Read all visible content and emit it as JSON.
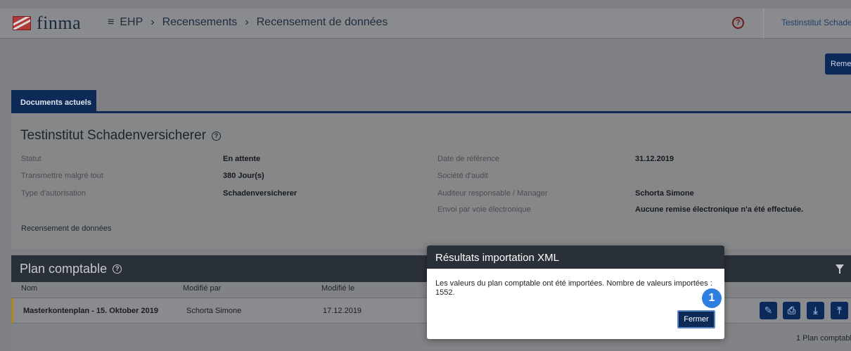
{
  "header": {
    "logo_text": "finma",
    "breadcrumb": [
      "EHP",
      "Recensements",
      "Recensement de données"
    ],
    "institution": "Testinstitut Schade"
  },
  "toolbar": {
    "submit_label": "Reme"
  },
  "tabs": [
    {
      "label": "Documents actuels",
      "active": true
    }
  ],
  "info": {
    "title": "Testinstitut Schadenversicherer",
    "fields_left": [
      {
        "label": "Statut",
        "value": "En attente"
      },
      {
        "label": "Transmettre malgré tout",
        "value": "380 Jour(s)"
      },
      {
        "label": "Type d'autorisation",
        "value": "Schadenversicherer"
      }
    ],
    "fields_right": [
      {
        "label": "Date de référence",
        "value": "31.12.2019"
      },
      {
        "label": "Société d'audit",
        "value": ""
      },
      {
        "label": "Auditeur responsable / Manager",
        "value": "Schorta Simone"
      },
      {
        "label": "Envoi par voie électronique",
        "value": "Aucune remise électronique n'a été effectuée."
      }
    ],
    "subtitle": "Recensement de données"
  },
  "plan": {
    "title": "Plan comptable",
    "columns": [
      "Nom",
      "Modifié par",
      "Modifié le"
    ],
    "rows": [
      {
        "name": "Masterkontenplan - 15. Oktober 2019",
        "modified_by": "Schorta Simone",
        "modified_on": "17.12.2019"
      }
    ],
    "footer": "1 Plan comptabl"
  },
  "modal": {
    "title": "Résultats importation XML",
    "message": "Les valeurs du plan comptable ont été importées. Nombre de valeurs importées : 1552.",
    "close_label": "Fermer"
  },
  "annotation": {
    "badge": "1"
  }
}
